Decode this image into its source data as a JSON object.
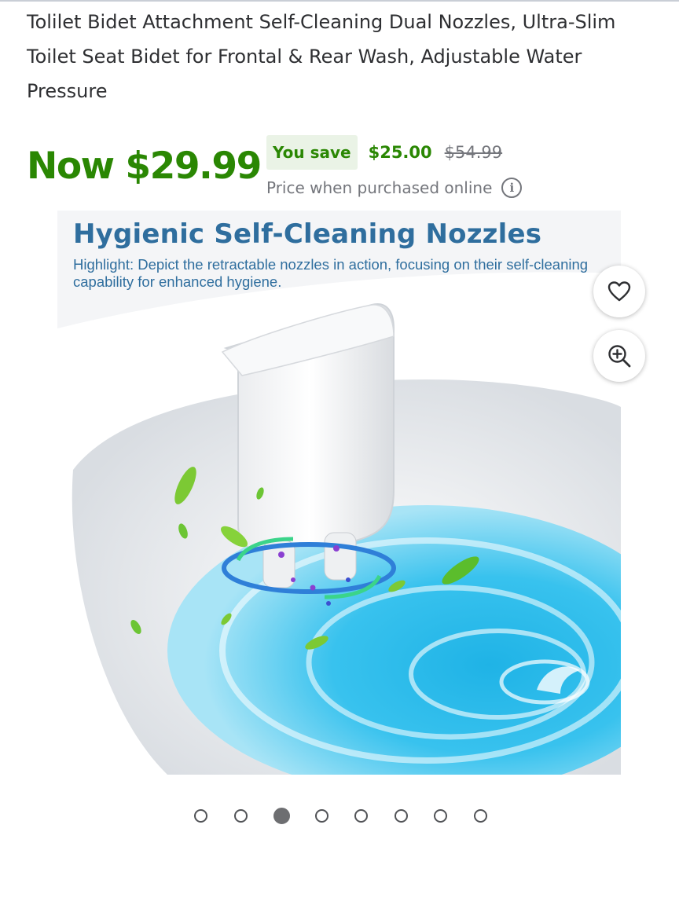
{
  "product": {
    "title": "Tolilet Bidet Attachment Self-Cleaning Dual Nozzles, Ultra-Slim Toilet Seat Bidet for Frontal & Rear Wash, Adjustable Water Pressure"
  },
  "price": {
    "now": "Now $29.99",
    "you_save_label": "You save",
    "save_amount": "$25.00",
    "was_price": "$54.99",
    "note": "Price when purchased online",
    "info_icon": "info-icon"
  },
  "image": {
    "heading": "Hygienic Self-Cleaning Nozzles",
    "caption": "Highlight: Depict the retractable nozzles in action, focusing on their self-cleaning capability for enhanced hygiene."
  },
  "actions": {
    "favorite_icon": "heart-icon",
    "zoom_icon": "zoom-in-icon"
  },
  "carousel": {
    "total": 8,
    "active_index": 2
  },
  "colors": {
    "price_green": "#2a8703",
    "badge_bg": "#eaf3e6",
    "muted_text": "#74767c",
    "heading_blue": "#2f6e9e"
  }
}
